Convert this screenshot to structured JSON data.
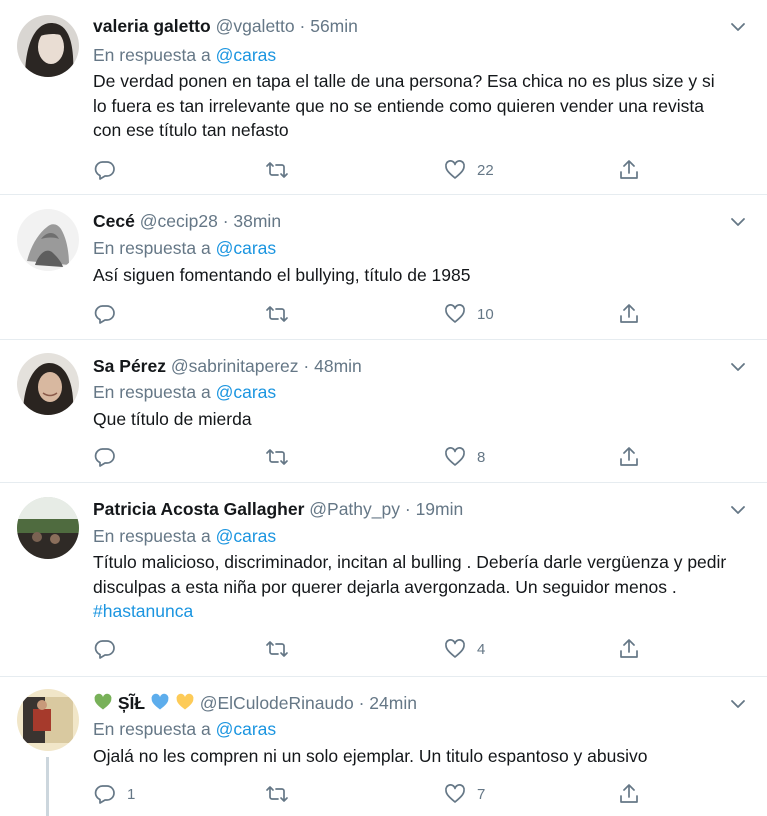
{
  "tweets": [
    {
      "name": "valeria galetto",
      "handle": "@vgaletto",
      "separator": "·",
      "time": "56min",
      "reply_prefix": "En respuesta a",
      "reply_to": "@caras",
      "text": "De verdad ponen en tapa el talle de una persona? Esa chica no es plus size y si lo fuera es tan irrelevante que no se entiende como quieren vender una revista con ese título tan nefasto",
      "reply_count": "",
      "retweet_count": "",
      "like_count": "22"
    },
    {
      "name": "Cecé",
      "handle": "@cecip28",
      "separator": "·",
      "time": "38min",
      "reply_prefix": "En respuesta a",
      "reply_to": "@caras",
      "text": "Así siguen fomentando el bullying, título de 1985",
      "reply_count": "",
      "retweet_count": "",
      "like_count": "10"
    },
    {
      "name": "Sa Pérez",
      "handle": "@sabrinitaperez",
      "separator": "·",
      "time": "48min",
      "reply_prefix": "En respuesta a",
      "reply_to": "@caras",
      "text": "Que título de mierda",
      "reply_count": "",
      "retweet_count": "",
      "like_count": "8"
    },
    {
      "name": "Patricia Acosta Gallagher",
      "handle": "@Pathy_py",
      "separator": "·",
      "time": "19min",
      "reply_prefix": "En respuesta a",
      "reply_to": "@caras",
      "text": "Título malicioso,  discriminador,  incitan al bulling . Debería darle vergüenza y pedir  disculpas a esta niña por querer dejarla avergonzada.  Un seguidor menos .",
      "hashtag": "#hastanunca",
      "reply_count": "",
      "retweet_count": "",
      "like_count": "4"
    },
    {
      "name": "ȘĨŁ",
      "handle": "@ElCulodeRinaudo",
      "separator": "·",
      "time": "24min",
      "reply_prefix": "En respuesta a",
      "reply_to": "@caras",
      "text": "Ojalá no les compren ni un solo ejemplar. Un titulo espantoso y abusivo",
      "reply_count": "1",
      "retweet_count": "",
      "like_count": "7"
    }
  ],
  "colors": {
    "accent": "#1b95e0",
    "muted": "#657786",
    "divider": "#e6ecf0",
    "text": "#14171a"
  },
  "icons": [
    "reply-icon",
    "retweet-icon",
    "like-icon",
    "share-icon",
    "chevron-down-icon",
    "green-heart-emoji",
    "blue-heart-emoji",
    "yellow-heart-emoji"
  ]
}
